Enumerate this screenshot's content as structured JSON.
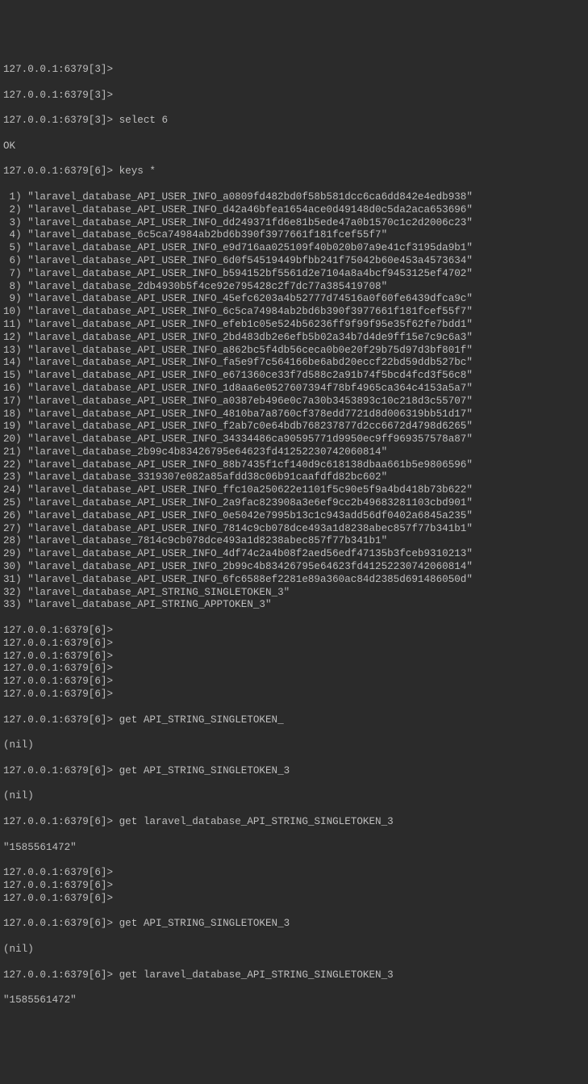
{
  "promptDB3": "127.0.0.1:6379[3]>",
  "promptDB6": "127.0.0.1:6379[6]>",
  "cmdSelect": "select 6",
  "respSelect": "OK",
  "cmdKeys": "keys *",
  "keys": [
    "laravel_database_API_USER_INFO_a0809fd482bd0f58b581dcc6ca6dd842e4edb938",
    "laravel_database_API_USER_INFO_d42a46bfea1654ace0d49148d0c5da2aca653696",
    "laravel_database_API_USER_INFO_dd249371fd6e81b5ede47a0b1570c1c2d2006c23",
    "laravel_database_6c5ca74984ab2bd6b390f3977661f181fcef55f7",
    "laravel_database_API_USER_INFO_e9d716aa025109f40b020b07a9e41cf3195da9b1",
    "laravel_database_API_USER_INFO_6d0f54519449bfbb241f75042b60e453a4573634",
    "laravel_database_API_USER_INFO_b594152bf5561d2e7104a8a4bcf9453125ef4702",
    "laravel_database_2db4930b5f4ce92e795428c2f7dc77a385419708",
    "laravel_database_API_USER_INFO_45efc6203a4b52777d74516a0f60fe6439dfca9c",
    "laravel_database_API_USER_INFO_6c5ca74984ab2bd6b390f3977661f181fcef55f7",
    "laravel_database_API_USER_INFO_efeb1c05e524b56236ff9f99f95e35f62fe7bdd1",
    "laravel_database_API_USER_INFO_2bd483db2e6efb5b02a34b7d4de9ff15e7c9c6a3",
    "laravel_database_API_USER_INFO_a862bc5f4db56ceca0b0e20f29b75d97d3bf801f",
    "laravel_database_API_USER_INFO_fa5e9f7c564166be6abd20eccf22bd59ddb527bc",
    "laravel_database_API_USER_INFO_e671360ce33f7d588c2a91b74f5bcd4fcd3f56c8",
    "laravel_database_API_USER_INFO_1d8aa6e0527607394f78bf4965ca364c4153a5a7",
    "laravel_database_API_USER_INFO_a0387eb496e0c7a30b3453893c10c218d3c55707",
    "laravel_database_API_USER_INFO_4810ba7a8760cf378edd7721d8d006319bb51d17",
    "laravel_database_API_USER_INFO_f2ab7c0e64bdb768237877d2cc6672d4798d6265",
    "laravel_database_API_USER_INFO_34334486ca90595771d9950ec9ff969357578a87",
    "laravel_database_2b99c4b83426795e64623fd41252230742060814",
    "laravel_database_API_USER_INFO_88b7435f1cf140d9c618138dbaa661b5e9806596",
    "laravel_database_3319307e082a85afdd38c06b91caafdfd82bc602",
    "laravel_database_API_USER_INFO_ffc10a250622e1101f5c90e5f9a4bd418b73b622",
    "laravel_database_API_USER_INFO_2a9fac823908a3e6ef9cc2b49683281103cbd901",
    "laravel_database_API_USER_INFO_0e5042e7995b13c1c943add56df0402a6845a235",
    "laravel_database_API_USER_INFO_7814c9cb078dce493a1d8238abec857f77b341b1",
    "laravel_database_7814c9cb078dce493a1d8238abec857f77b341b1",
    "laravel_database_API_USER_INFO_4df74c2a4b08f2aed56edf47135b3fceb9310213",
    "laravel_database_API_USER_INFO_2b99c4b83426795e64623fd41252230742060814",
    "laravel_database_API_USER_INFO_6fc6588ef2281e89a360ac84d2385d691486050d",
    "laravel_database_API_STRING_SINGLETOKEN_3",
    "laravel_database_API_STRING_APPTOKEN_3"
  ],
  "emptyPrompts": 6,
  "cmdGet1": "get API_STRING_SINGLETOKEN_",
  "respNil": "(nil)",
  "cmdGet2": "get API_STRING_SINGLETOKEN_3",
  "cmdGet3": "get laravel_database_API_STRING_SINGLETOKEN_3",
  "respVal": "\"1585561472\"",
  "emptyPrompts2": 3,
  "cmdGet4": "get API_STRING_SINGLETOKEN_3",
  "cmdGet5": "get laravel_database_API_STRING_SINGLETOKEN_3",
  "respValPartial": "\"1585561472\""
}
